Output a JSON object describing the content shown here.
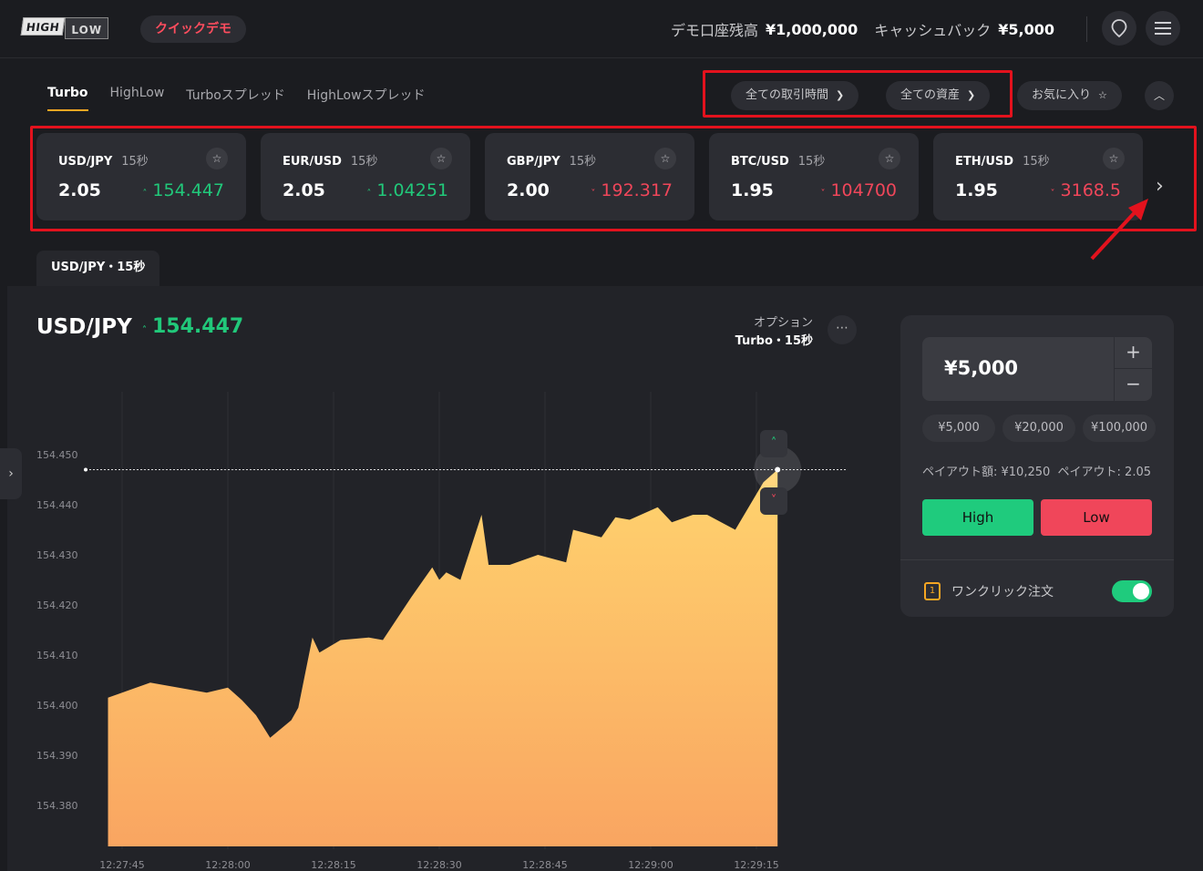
{
  "header": {
    "logo_high": "HIGH",
    "logo_low": "LOW",
    "demo_label": "クイックデモ",
    "balance_label": "デモ口座残高",
    "balance_value": "¥1,000,000",
    "cashback_label": "キャッシュバック",
    "cashback_value": "¥5,000"
  },
  "tabs": [
    "Turbo",
    "HighLow",
    "Turboスプレッド",
    "HighLowスプレッド"
  ],
  "filters": {
    "trade_time": "全ての取引時間",
    "assets": "全ての資産",
    "favorites": "お気に入り"
  },
  "asset_cards": [
    {
      "symbol": "USD/JPY",
      "duration": "15秒",
      "payout": "2.05",
      "price": "154.447",
      "direction": "up"
    },
    {
      "symbol": "EUR/USD",
      "duration": "15秒",
      "payout": "2.05",
      "price": "1.04251",
      "direction": "up"
    },
    {
      "symbol": "GBP/JPY",
      "duration": "15秒",
      "payout": "2.00",
      "price": "192.317",
      "direction": "down"
    },
    {
      "symbol": "BTC/USD",
      "duration": "15秒",
      "payout": "1.95",
      "price": "104700",
      "direction": "down"
    },
    {
      "symbol": "ETH/USD",
      "duration": "15秒",
      "payout": "1.95",
      "price": "3168.5",
      "direction": "down"
    }
  ],
  "chart_tab": "USD/JPY・15秒",
  "main": {
    "symbol": "USD/JPY",
    "price": "154.447",
    "option_label": "オプション",
    "option_value": "Turbo・15秒"
  },
  "trade": {
    "amount": "¥5,000",
    "presets": [
      "¥5,000",
      "¥20,000",
      "¥100,000"
    ],
    "payout_amount": "ペイアウト額: ¥10,250",
    "payout_rate": "ペイアウト: 2.05",
    "high_label": "High",
    "low_label": "Low",
    "oneclick_label": "ワンクリック注文",
    "oneclick_on": true
  },
  "colors": {
    "up": "#21c87a",
    "down": "#f0465a",
    "area_top": "#ffd36e",
    "area_bottom": "#f9a561",
    "highlight": "#e3121d"
  },
  "chart_data": {
    "type": "area",
    "ylabel": "",
    "xlabel": "",
    "y_ticks": [
      "154.450",
      "154.440",
      "154.430",
      "154.420",
      "154.410",
      "154.400",
      "154.390",
      "154.380"
    ],
    "x_ticks": [
      "12:27:45",
      "12:28:00",
      "12:28:15",
      "12:28:30",
      "12:28:45",
      "12:29:00",
      "12:29:15"
    ],
    "ylim": [
      154.3735,
      154.4515
    ],
    "current_price": 154.447,
    "series": [
      {
        "values": [
          [
            "12:27:43",
            154.4015
          ],
          [
            "12:27:46",
            154.403
          ],
          [
            "12:27:49",
            154.4045
          ],
          [
            "12:27:53",
            154.4035
          ],
          [
            "12:27:57",
            154.4025
          ],
          [
            "12:28:00",
            154.4035
          ],
          [
            "12:28:02",
            154.401
          ],
          [
            "12:28:04",
            154.398
          ],
          [
            "12:28:06",
            154.3935
          ],
          [
            "12:28:09",
            154.397
          ],
          [
            "12:28:10",
            154.3995
          ],
          [
            "12:28:12",
            154.4135
          ],
          [
            "12:28:13",
            154.4105
          ],
          [
            "12:28:16",
            154.413
          ],
          [
            "12:28:20",
            154.4135
          ],
          [
            "12:28:22",
            154.413
          ],
          [
            "12:28:26",
            154.4215
          ],
          [
            "12:28:29",
            154.4275
          ],
          [
            "12:28:30",
            154.425
          ],
          [
            "12:28:31",
            154.4265
          ],
          [
            "12:28:33",
            154.425
          ],
          [
            "12:28:36",
            154.438
          ],
          [
            "12:28:37",
            154.428
          ],
          [
            "12:28:40",
            154.428
          ],
          [
            "12:28:44",
            154.43
          ],
          [
            "12:28:48",
            154.4285
          ],
          [
            "12:28:49",
            154.435
          ],
          [
            "12:28:53",
            154.4335
          ],
          [
            "12:28:55",
            154.4375
          ],
          [
            "12:28:57",
            154.437
          ],
          [
            "12:29:01",
            154.4395
          ],
          [
            "12:29:03",
            154.4365
          ],
          [
            "12:29:06",
            154.438
          ],
          [
            "12:29:08",
            154.438
          ],
          [
            "12:29:12",
            154.435
          ],
          [
            "12:29:16",
            154.4445
          ],
          [
            "12:29:18",
            154.447
          ]
        ]
      }
    ]
  }
}
